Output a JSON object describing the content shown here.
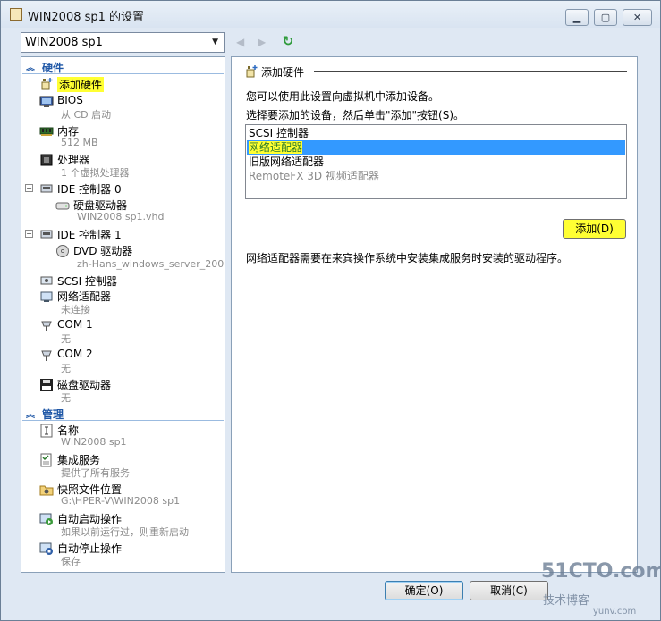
{
  "window": {
    "title": "WIN2008 sp1 的设置"
  },
  "vm_selector": {
    "value": "WIN2008 sp1"
  },
  "hardware_section": {
    "label": "硬件"
  },
  "management_section": {
    "label": "管理"
  },
  "hardware_items": [
    {
      "label": "添加硬件",
      "sub": ""
    },
    {
      "label": "BIOS",
      "sub": "从 CD 启动"
    },
    {
      "label": "内存",
      "sub": "512 MB"
    },
    {
      "label": "处理器",
      "sub": "1 个虚拟处理器"
    },
    {
      "label": "IDE 控制器 0",
      "sub": ""
    },
    {
      "label": "硬盘驱动器",
      "sub": "WIN2008 sp1.vhd"
    },
    {
      "label": "IDE 控制器 1",
      "sub": ""
    },
    {
      "label": "DVD 驱动器",
      "sub": "zh-Hans_windows_server_200..."
    },
    {
      "label": "SCSI 控制器",
      "sub": ""
    },
    {
      "label": "网络适配器",
      "sub": "未连接"
    },
    {
      "label": "COM 1",
      "sub": "无"
    },
    {
      "label": "COM 2",
      "sub": "无"
    },
    {
      "label": "磁盘驱动器",
      "sub": "无"
    }
  ],
  "management_items": [
    {
      "label": "名称",
      "sub": "WIN2008 sp1"
    },
    {
      "label": "集成服务",
      "sub": "提供了所有服务"
    },
    {
      "label": "快照文件位置",
      "sub": "G:\\HPER-V\\WIN2008 sp1"
    },
    {
      "label": "自动启动操作",
      "sub": "如果以前运行过，则重新启动"
    },
    {
      "label": "自动停止操作",
      "sub": "保存"
    }
  ],
  "right": {
    "title": "添加硬件",
    "line1": "您可以使用此设置向虚拟机中添加设备。",
    "line2": "选择要添加的设备，然后单击\"添加\"按钮(S)。",
    "options": [
      "SCSI 控制器",
      "网络适配器",
      "旧版网络适配器",
      "RemoteFX 3D 视频适配器"
    ],
    "selected_option": "网络适配器",
    "add_button": "添加(D)",
    "description": "网络适配器需要在来宾操作系统中安装集成服务时安装的驱动程序。"
  },
  "buttons": {
    "ok": "确定(O)",
    "cancel": "取消(C)"
  },
  "watermark": {
    "main": "51CTO.com",
    "sub": "技术博客",
    "site": "yunv.com"
  }
}
